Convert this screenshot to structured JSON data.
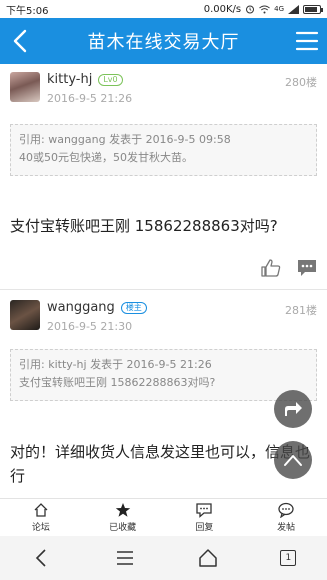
{
  "status_bar": {
    "time": "下午5:06",
    "speed": "0.00K/s",
    "network": "4G"
  },
  "header": {
    "title": "苗木在线交易大厅"
  },
  "posts": [
    {
      "username": "kitty-hj",
      "badge": "Lv0",
      "time": "2016-9-5 21:26",
      "floor": "280楼",
      "quote_line1": "引用: wanggang 发表于 2016-9-5 09:58",
      "quote_line2": "40或50元包快递，50发甘秋大苗。",
      "text": "支付宝转账吧王刚 15862288863对吗?"
    },
    {
      "username": "wanggang",
      "badge": "楼主",
      "time": "2016-9-5 21:30",
      "floor": "281楼",
      "quote_line1": "引用: kitty-hj 发表于 2016-9-5 21:26",
      "quote_line2": "支付宝转账吧王刚 15862288863对吗?",
      "text": "对的！详细收货人信息发这里也可以，信息也行"
    }
  ],
  "tabs": [
    {
      "label": "论坛",
      "icon": "home-icon"
    },
    {
      "label": "已收藏",
      "icon": "star-icon"
    },
    {
      "label": "回复",
      "icon": "reply-icon"
    },
    {
      "label": "发帖",
      "icon": "compose-icon"
    }
  ],
  "navbar": {
    "recent_count": "1"
  },
  "colors": {
    "primary": "#1a8fe0",
    "level_badge": "#7cc35a"
  }
}
